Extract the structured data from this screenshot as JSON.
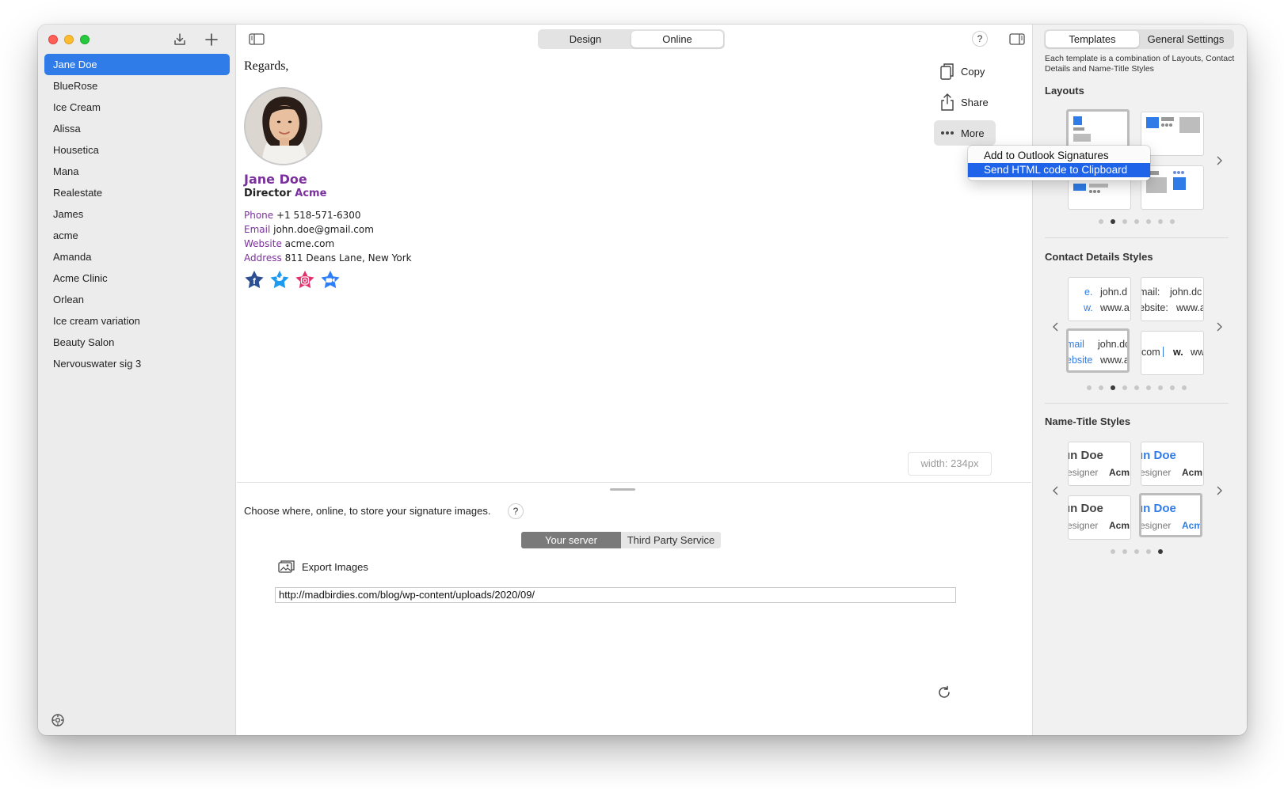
{
  "sidebar": {
    "signatures": [
      {
        "name": "Jane Doe",
        "selected": true
      },
      {
        "name": "BlueRose"
      },
      {
        "name": "Ice Cream"
      },
      {
        "name": "Alissa"
      },
      {
        "name": "Housetica"
      },
      {
        "name": "Mana"
      },
      {
        "name": "Realestate"
      },
      {
        "name": "James"
      },
      {
        "name": "acme"
      },
      {
        "name": "Amanda"
      },
      {
        "name": "Acme Clinic"
      },
      {
        "name": "Orlean"
      },
      {
        "name": "Ice cream variation"
      },
      {
        "name": "Beauty Salon"
      },
      {
        "name": "Nervouswater sig 3"
      }
    ]
  },
  "toolbar": {
    "tabs": [
      {
        "label": "Design",
        "active": false
      },
      {
        "label": "Online",
        "active": true
      }
    ],
    "help_label": "?"
  },
  "preview": {
    "greeting": "Regards,",
    "name": "Jane Doe",
    "title": "Director",
    "company": "Acme",
    "details": [
      {
        "label": "Phone",
        "value": "+1 518-571-6300"
      },
      {
        "label": "Email",
        "value": "john.doe@gmail.com"
      },
      {
        "label": "Website",
        "value": "acme.com"
      },
      {
        "label": "Address",
        "value": "811 Deans Lane, New York"
      }
    ],
    "socials": [
      "facebook-icon",
      "twitter-icon",
      "instagram-icon",
      "zoom-icon"
    ],
    "width_label": "width: 234px"
  },
  "actions": {
    "copy": "Copy",
    "share": "Share",
    "more": "More"
  },
  "more_menu": {
    "items": [
      {
        "label": "Add to Outlook Signatures",
        "highlighted": false
      },
      {
        "label": "Send HTML code to Clipboard",
        "highlighted": true
      }
    ]
  },
  "online": {
    "store_label": "Choose where, online, to store your signature images.",
    "help_label": "?",
    "storage_options": [
      {
        "label": "Your server",
        "active": true
      },
      {
        "label": "Third Party Service",
        "active": false
      }
    ],
    "export_label": "Export Images",
    "url_value": "http://madbirdies.com/blog/wp-content/uploads/2020/09/"
  },
  "right_panel": {
    "tabs": [
      {
        "label": "Templates",
        "active": true
      },
      {
        "label": "General Settings",
        "active": false
      }
    ],
    "description": "Each template is a combination of Layouts, Contact Details and Name-Title Styles",
    "layouts_title": "Layouts",
    "layouts_page": {
      "count": 7,
      "current": 1
    },
    "contact_title": "Contact Details Styles",
    "contact_page": {
      "count": 9,
      "current": 2
    },
    "contact_thumbs": [
      {
        "l1": "e.",
        "v1": "john.d",
        "l2": "w.",
        "v2": "www.a"
      },
      {
        "l1": "mail:",
        "v1": "john.dc",
        "l2": "ebsite:",
        "v2": "www.a"
      },
      {
        "l1": "mail",
        "v1": "john.dc",
        "l2": "ebsite",
        "v2": "www.a"
      },
      {
        "l1": "com",
        "v1": "w.",
        "l2": "",
        "v2": "ww"
      }
    ],
    "name_title": "Name-Title Styles",
    "name_page": {
      "count": 5,
      "current": 4
    },
    "name_thumbs": [
      {
        "name": "ın Doe",
        "role": "esigner",
        "company": "Acm"
      },
      {
        "name": "ın Doe",
        "role": "esigner",
        "company": "Acm"
      },
      {
        "name": "ın Doe",
        "role": "esigner",
        "company": "Acm"
      },
      {
        "name": "ın Doe",
        "role": "esigner",
        "company": "Acm"
      }
    ]
  },
  "colors": {
    "accent": "#2f7ce9",
    "signature_purple": "#7b2f9d",
    "menu_highlight": "#1f63e8"
  }
}
